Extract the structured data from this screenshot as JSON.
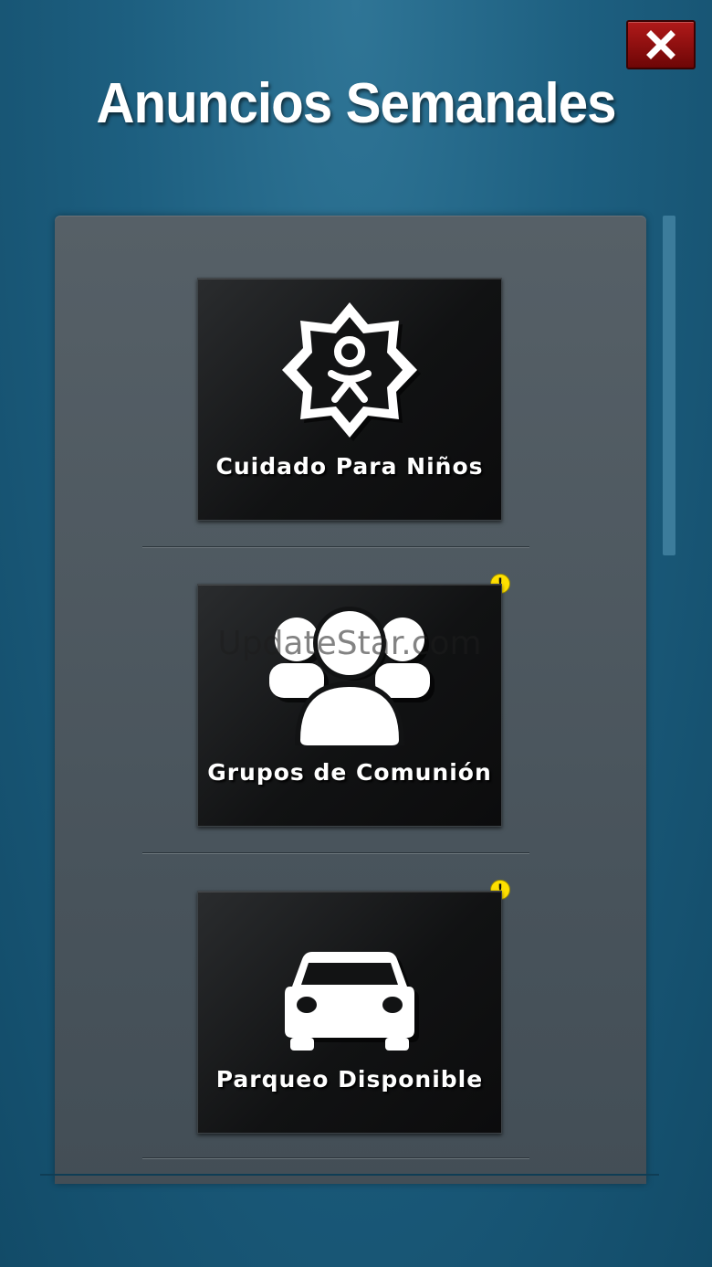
{
  "header": {
    "title": "Anuncios Semanales",
    "close_icon": "close-icon"
  },
  "tiles": [
    {
      "label": "Cuidado Para Niños",
      "icon": "child-care-badge-icon",
      "has_alert": false
    },
    {
      "label": "Grupos de Comunión",
      "icon": "people-group-icon",
      "has_alert": true,
      "alert": "!",
      "watermark": "UpdateStar.com"
    },
    {
      "label": "Parqueo Disponible",
      "icon": "car-icon",
      "has_alert": true,
      "alert": "!"
    }
  ],
  "colors": {
    "background": "#1d5f80",
    "panel": "#4d575f",
    "tile": "#121314",
    "close_button": "#8e0e0e",
    "alert_badge": "#ffe000",
    "scrollbar": "#3c7c9b"
  }
}
